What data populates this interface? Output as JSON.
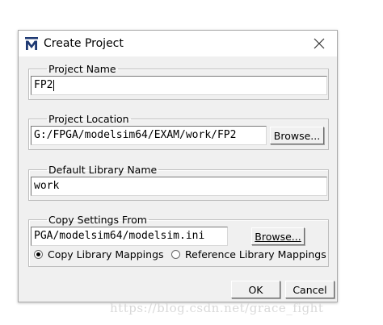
{
  "window": {
    "title": "Create Project",
    "icon": "modelsim-m-icon",
    "close_icon": "close-icon"
  },
  "project_name": {
    "legend": "Project Name",
    "value": "FP2"
  },
  "project_location": {
    "legend": "Project Location",
    "value": "G:/FPGA/modelsim64/EXAM/work/FP2",
    "browse_label": "Browse..."
  },
  "default_library": {
    "legend": "Default Library Name",
    "value": "work"
  },
  "copy_settings": {
    "legend": "Copy Settings From",
    "value": "PGA/modelsim64/modelsim.ini",
    "browse_label": "Browse...",
    "options": [
      {
        "label": "Copy Library Mappings",
        "selected": true
      },
      {
        "label": "Reference Library Mappings",
        "selected": false
      }
    ]
  },
  "footer": {
    "ok_label": "OK",
    "cancel_label": "Cancel"
  },
  "watermark": "https://blog.csdn.net/grace_fight"
}
